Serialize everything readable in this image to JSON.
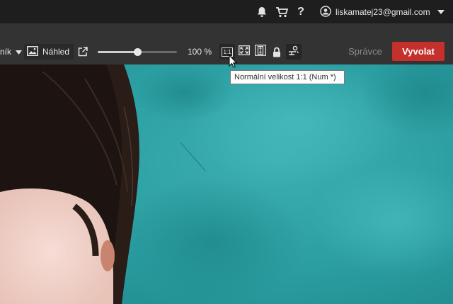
{
  "topbar": {
    "icons": [
      "bell-icon",
      "cart-icon",
      "help-icon",
      "user-icon",
      "chevron-down-icon"
    ],
    "help_label": "?",
    "account_email": "liskamatej23@gmail.com"
  },
  "toolbar": {
    "mode_label": "ník",
    "preview_label": "Náhled",
    "zoom_level": 0.5,
    "zoom_text": "100 %",
    "one_to_one_label": "1:1",
    "spravce_label": "Správce",
    "vyvolat_label": "Vyvolat"
  },
  "tooltip": {
    "text": "Normální velikost 1:1 (Num *)"
  },
  "colors": {
    "accent": "#c4302b",
    "topbar": "#1e1e1e",
    "toolbar": "#333333",
    "photo_bg": "#2a9a9e"
  }
}
